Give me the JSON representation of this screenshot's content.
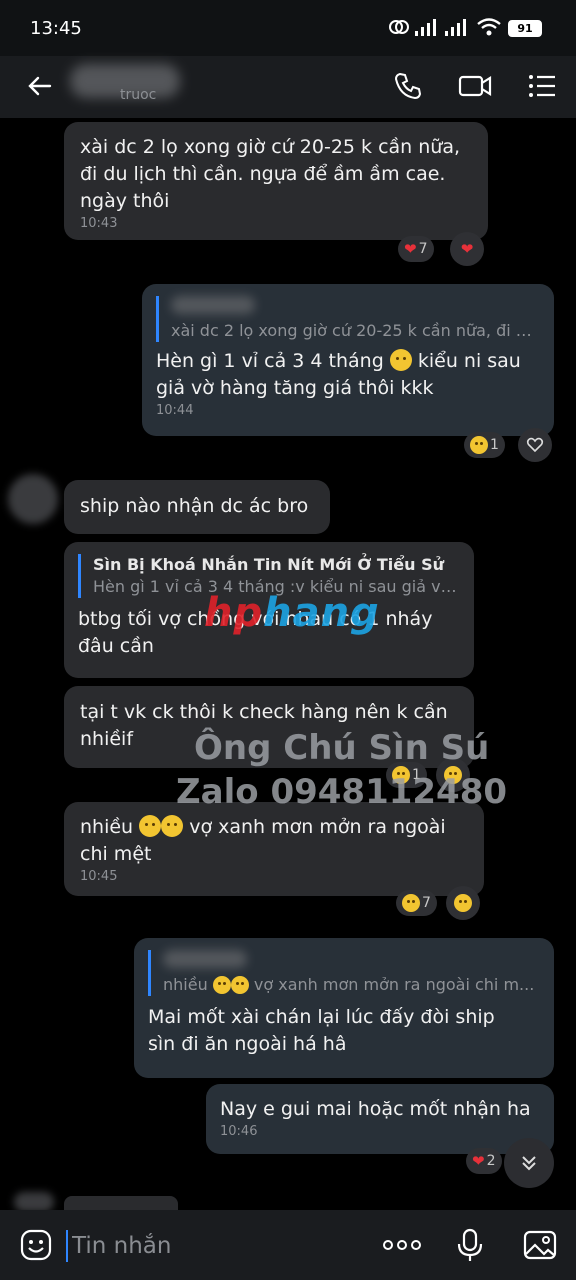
{
  "status_bar": {
    "time": "13:45",
    "battery": "91"
  },
  "header": {
    "status_fragment": "truoc"
  },
  "messages": [
    {
      "text": "xài dc 2 lọ xong giờ cứ 20-25 k cần nữa,\nđi du lịch thì cần. ngựa để ầm ầm cae.\nngày thôi",
      "time": "10:43",
      "reaction_count": "7"
    },
    {
      "quote_text": "xài dc 2 lọ xong giờ cứ 20-25 k cần nữa, đi d...",
      "text_a": "Hèn gì 1 vỉ cả 3 4 tháng",
      "text_b": "kiểu ni sau",
      "text_c": "giả vờ hàng tăng giá thôi kkk",
      "time": "10:44",
      "reaction_count": "1"
    },
    {
      "text": "ship nào nhận dc ác bro"
    },
    {
      "quote_author": "Sìn Bị Khoá Nhắn Tin Nít Mới Ở Tiểu Sử",
      "quote_text": "Hèn gì 1 vỉ cả 3 4 tháng :v kiểu ni sau giả vờ...",
      "text": "btbg tối vợ chồng với nhau có 1 nháy\nđâu cần"
    },
    {
      "text": "tại t vk ck thôi k check hàng nên k cần\nnhiềif",
      "reaction_count": "1"
    },
    {
      "text_a": "nhiều",
      "text_b": "vợ xanh mơn mởn ra ngoài",
      "text_c": "chi mệt",
      "time": "10:45",
      "reaction_count": "7"
    },
    {
      "quote_text_a": "nhiều",
      "quote_text_b": "vợ xanh mơn mởn ra ngoài chi m...",
      "text": "Mai mốt xài chán lại lúc đấy đòi ship\nsìn đi ăn ngoài há hâ"
    },
    {
      "text": "Nay e gui mai hoặc mốt nhận ha",
      "time": "10:46",
      "reaction_count": "2"
    }
  ],
  "watermark": {
    "logo_a": "hp",
    "logo_b": "hang",
    "name": "Ông Chú Sìn Sú",
    "phone": "Zalo 0948112480"
  },
  "input": {
    "placeholder": "Tin nhắn"
  },
  "icons": {
    "back": "arrow-left-icon",
    "call": "phone-icon",
    "video": "video-camera-icon",
    "menu": "list-menu-icon",
    "emoji": "emoji-icon",
    "more": "more-dots-icon",
    "mic": "microphone-icon",
    "image": "image-icon",
    "scroll": "chevron-down-double-icon"
  },
  "colors": {
    "accent": "#2f86ff",
    "bubble_in": "#2a2b2e",
    "bubble_out": "#283038",
    "heart": "#e8313a"
  }
}
